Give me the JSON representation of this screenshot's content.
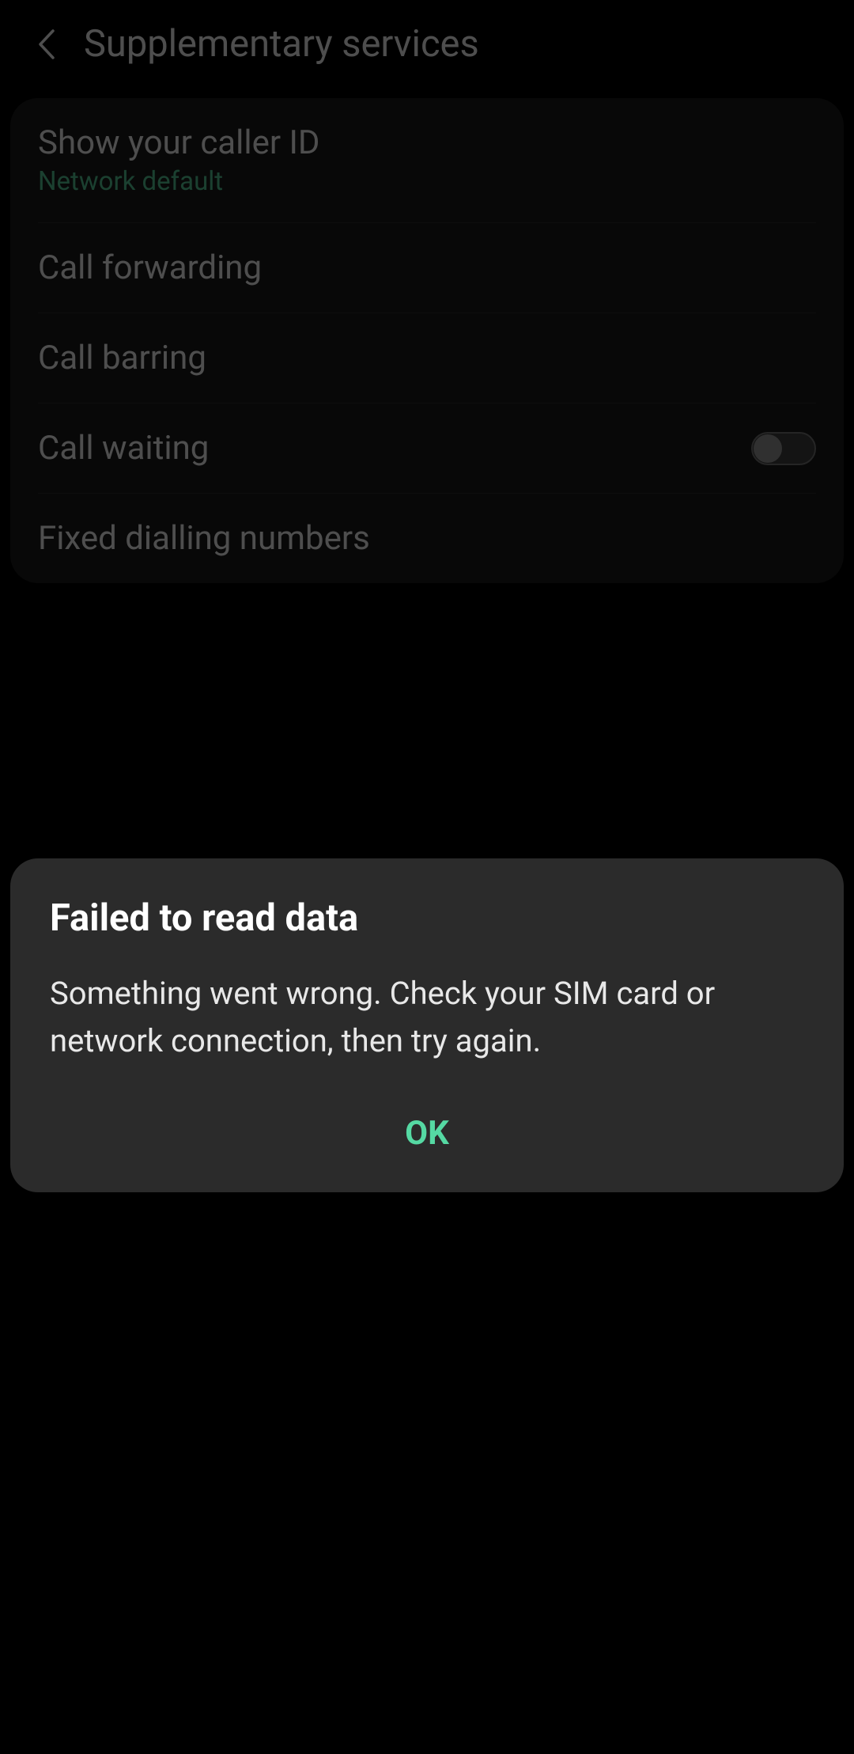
{
  "header": {
    "title": "Supplementary services"
  },
  "settings": {
    "caller_id": {
      "title": "Show your caller ID",
      "value": "Network default"
    },
    "call_forwarding": {
      "title": "Call forwarding"
    },
    "call_barring": {
      "title": "Call barring"
    },
    "call_waiting": {
      "title": "Call waiting",
      "enabled": false
    },
    "fixed_dialling": {
      "title": "Fixed dialling numbers"
    }
  },
  "dialog": {
    "title": "Failed to read data",
    "message": "Something went wrong. Check your SIM card or network connection, then try again.",
    "button": "OK"
  },
  "colors": {
    "accent": "#55d9a3",
    "secondary_accent": "#4db88a"
  }
}
